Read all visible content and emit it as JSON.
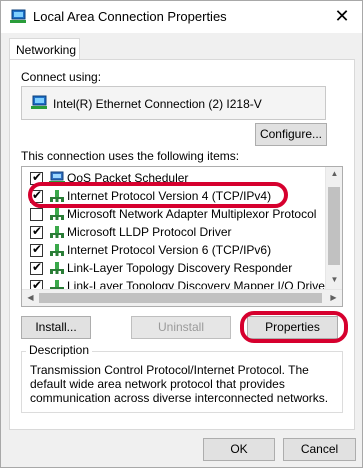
{
  "window": {
    "title": "Local Area Connection Properties",
    "close_glyph": "✕"
  },
  "tabs": [
    {
      "label": "Networking"
    }
  ],
  "connect_using": {
    "label": "Connect using:",
    "adapter_name": "Intel(R) Ethernet Connection (2) I218-V",
    "configure_label": "Configure..."
  },
  "items_section": {
    "label": "This connection uses the following items:",
    "items": [
      {
        "label": "QoS Packet Scheduler",
        "checked": true,
        "icon": "qos-scheduler-icon"
      },
      {
        "label": "Internet Protocol Version 4 (TCP/IPv4)",
        "checked": true,
        "icon": "network-protocol-icon",
        "selected": true
      },
      {
        "label": "Microsoft Network Adapter Multiplexor Protocol",
        "checked": false,
        "icon": "network-protocol-icon"
      },
      {
        "label": "Microsoft LLDP Protocol Driver",
        "checked": true,
        "icon": "network-protocol-icon"
      },
      {
        "label": "Internet Protocol Version 6 (TCP/IPv6)",
        "checked": true,
        "icon": "network-protocol-icon"
      },
      {
        "label": "Link-Layer Topology Discovery Responder",
        "checked": true,
        "icon": "network-protocol-icon"
      },
      {
        "label": "Link-Layer Topology Discovery Mapper I/O Driver",
        "checked": true,
        "icon": "network-protocol-icon"
      }
    ]
  },
  "buttons": {
    "install": "Install...",
    "uninstall": "Uninstall",
    "properties": "Properties",
    "ok": "OK",
    "cancel": "Cancel"
  },
  "description": {
    "legend": "Description",
    "text": "Transmission Control Protocol/Internet Protocol. The default wide area network protocol that provides communication across diverse interconnected networks."
  },
  "colors": {
    "highlight_annotation": "#d6002e",
    "focus_border": "#0078d7"
  }
}
